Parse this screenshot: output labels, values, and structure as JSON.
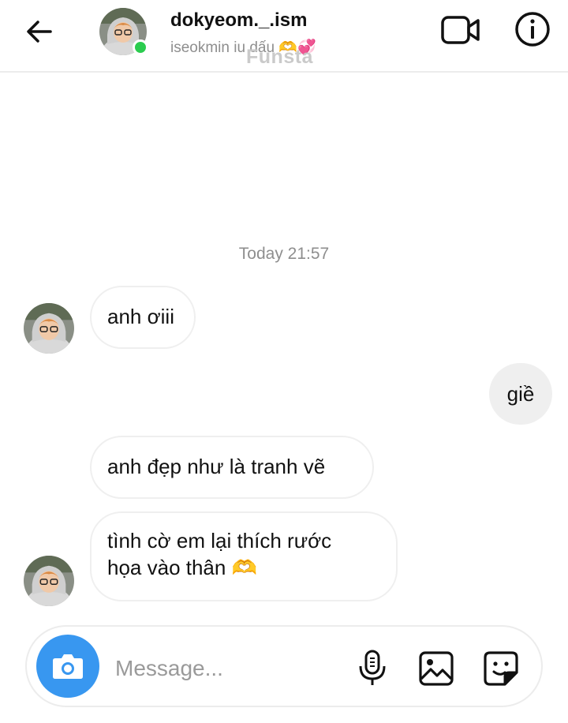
{
  "header": {
    "username": "dokyeom._.ism",
    "subtitle": "iseokmin iu dấu 🫶💞",
    "watermark": "Funsta"
  },
  "timestamp": "Today 21:57",
  "messages": [
    {
      "text": "anh ơiii",
      "direction": "incoming"
    },
    {
      "text": "giề",
      "direction": "outgoing"
    },
    {
      "text": "anh đẹp như là tranh vẽ",
      "direction": "incoming"
    },
    {
      "text": "tình cờ em lại thích rước",
      "direction": "incoming"
    },
    {
      "text": "họa vào thân 🫶",
      "direction": "incoming"
    }
  ],
  "composer": {
    "placeholder": "Message..."
  },
  "icons": {
    "back": "arrow-left-icon",
    "video": "video-call-icon",
    "info": "info-icon",
    "camera": "camera-icon",
    "mic": "microphone-icon",
    "gallery": "image-gallery-icon",
    "sticker": "sticker-icon"
  },
  "colors": {
    "online": "#2bcc4f",
    "camera_button": "#3897f0",
    "outgoing_bubble": "#efefef"
  }
}
